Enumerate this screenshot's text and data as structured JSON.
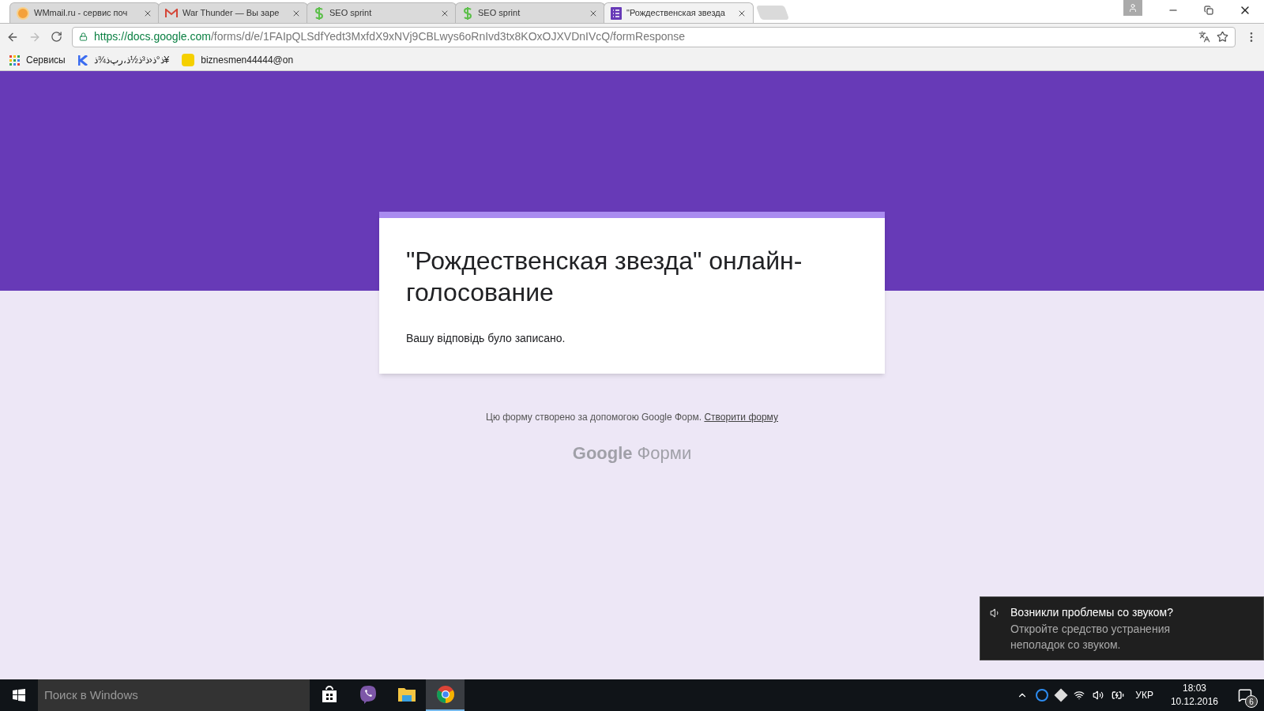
{
  "tabs": [
    {
      "title": "WMmail.ru - сервис поч",
      "selected": false,
      "kind": "orange"
    },
    {
      "title": "War Thunder — Вы заре",
      "selected": false,
      "kind": "gmail"
    },
    {
      "title": "SEO sprint",
      "selected": false,
      "kind": "seo"
    },
    {
      "title": "SEO sprint",
      "selected": false,
      "kind": "seo"
    },
    {
      "title": "\"Рождественская звезда",
      "selected": true,
      "kind": "forms"
    }
  ],
  "address_bar": {
    "host": "https://docs.google.com",
    "path": "/forms/d/e/1FAIpQLSdfYedt3MxfdX9xNVj9CBLwys6oRnIvd3tx8KOxOJXVDnIVcQ/formResponse"
  },
  "bookmarks": [
    {
      "label": "Сервисы",
      "kind": "apps"
    },
    {
      "label": "ﺫ°ﺫ‹ﺫ³ﺫ½ﺫ،ﺭﭖﺫ¾ﺫ¥",
      "kind": "k"
    },
    {
      "label": "biznesmen44444@on",
      "kind": "ua"
    }
  ],
  "form": {
    "title": "\"Рождественская звезда\" онлайн-голосование",
    "message": "Вашу відповідь було записано."
  },
  "footer": {
    "text": "Цю форму створено за допомогою Google Форм.",
    "link": "Створити форму",
    "logo_google": "Google",
    "logo_product": "Форми"
  },
  "notification": {
    "title": "Возникли проблемы со звуком?",
    "body": "Откройте средство устранения неполадок со звуком."
  },
  "taskbar": {
    "search_placeholder": "Поиск в Windows",
    "apps": [
      {
        "kind": "store",
        "selected": false
      },
      {
        "kind": "viber",
        "selected": false
      },
      {
        "kind": "explorer",
        "selected": false
      },
      {
        "kind": "chrome",
        "selected": true
      }
    ],
    "language": "УКР",
    "time": "18:03",
    "date": "10.12.2016",
    "notification_count": "6"
  }
}
